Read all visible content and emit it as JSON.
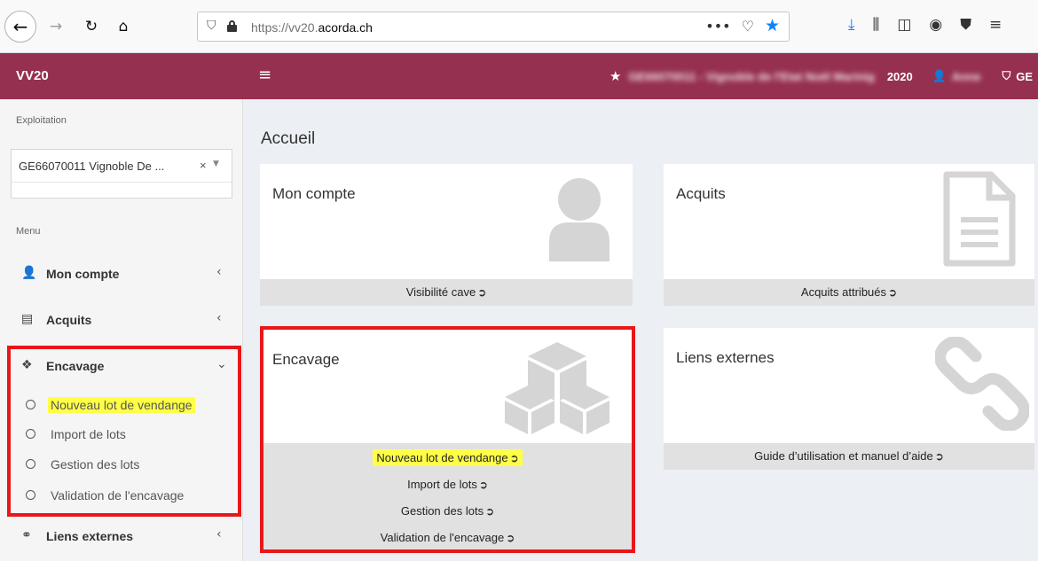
{
  "browser": {
    "back_glyph": "←",
    "forward_glyph": "→",
    "reload_glyph": "↻",
    "home_glyph": "⌂",
    "url_prefix": "https://vv20.",
    "url_host": "acorda.ch",
    "page_actions": [
      "•••",
      "♡",
      "★"
    ],
    "toolbar_icons": [
      "download-icon",
      "library-icon",
      "sidebar-icon",
      "account-icon",
      "extension-icon",
      "menu-icon"
    ]
  },
  "header": {
    "logo": "VV20",
    "year": "2020",
    "org_redacted": "GE66070011 - Vignoble de l'Etat Noël Marinig",
    "user_redacted": "Anne",
    "region": "GE"
  },
  "sidebar": {
    "exploitation_label": "Exploitation",
    "select_value": "GE66070011 Vignoble De ...",
    "select_clear": "×",
    "menu_label": "Menu",
    "items": [
      {
        "label": "Mon compte",
        "icon": "user-icon",
        "chevron": "‹"
      },
      {
        "label": "Acquits",
        "icon": "document-icon",
        "chevron": "‹"
      },
      {
        "label": "Encavage",
        "icon": "cubes-icon",
        "chevron": "⌄"
      },
      {
        "label": "Liens externes",
        "icon": "link-icon",
        "chevron": "‹"
      }
    ],
    "encavage_sub": [
      {
        "label": "Nouveau lot de vendange"
      },
      {
        "label": "Import de lots"
      },
      {
        "label": "Gestion des lots"
      },
      {
        "label": "Validation de l'encavage"
      }
    ]
  },
  "main": {
    "title": "Accueil",
    "cards": [
      {
        "title": "Mon compte",
        "icon": "user-icon",
        "links": [
          "Visibilité cave"
        ]
      },
      {
        "title": "Acquits",
        "icon": "document-icon",
        "links": [
          "Acquits attribués"
        ]
      },
      {
        "title": "Encavage",
        "icon": "cubes-icon",
        "links": [
          "Nouveau lot de vendange",
          "Import de lots",
          "Gestion des lots",
          "Validation de l'encavage"
        ]
      },
      {
        "title": "Liens externes",
        "icon": "link-icon",
        "links": [
          "Guide d’utilisation et manuel d’aide"
        ]
      }
    ]
  },
  "colors": {
    "header_bg": "#963050",
    "highlight": "#ffff47",
    "annotation_red": "#e8171a"
  }
}
